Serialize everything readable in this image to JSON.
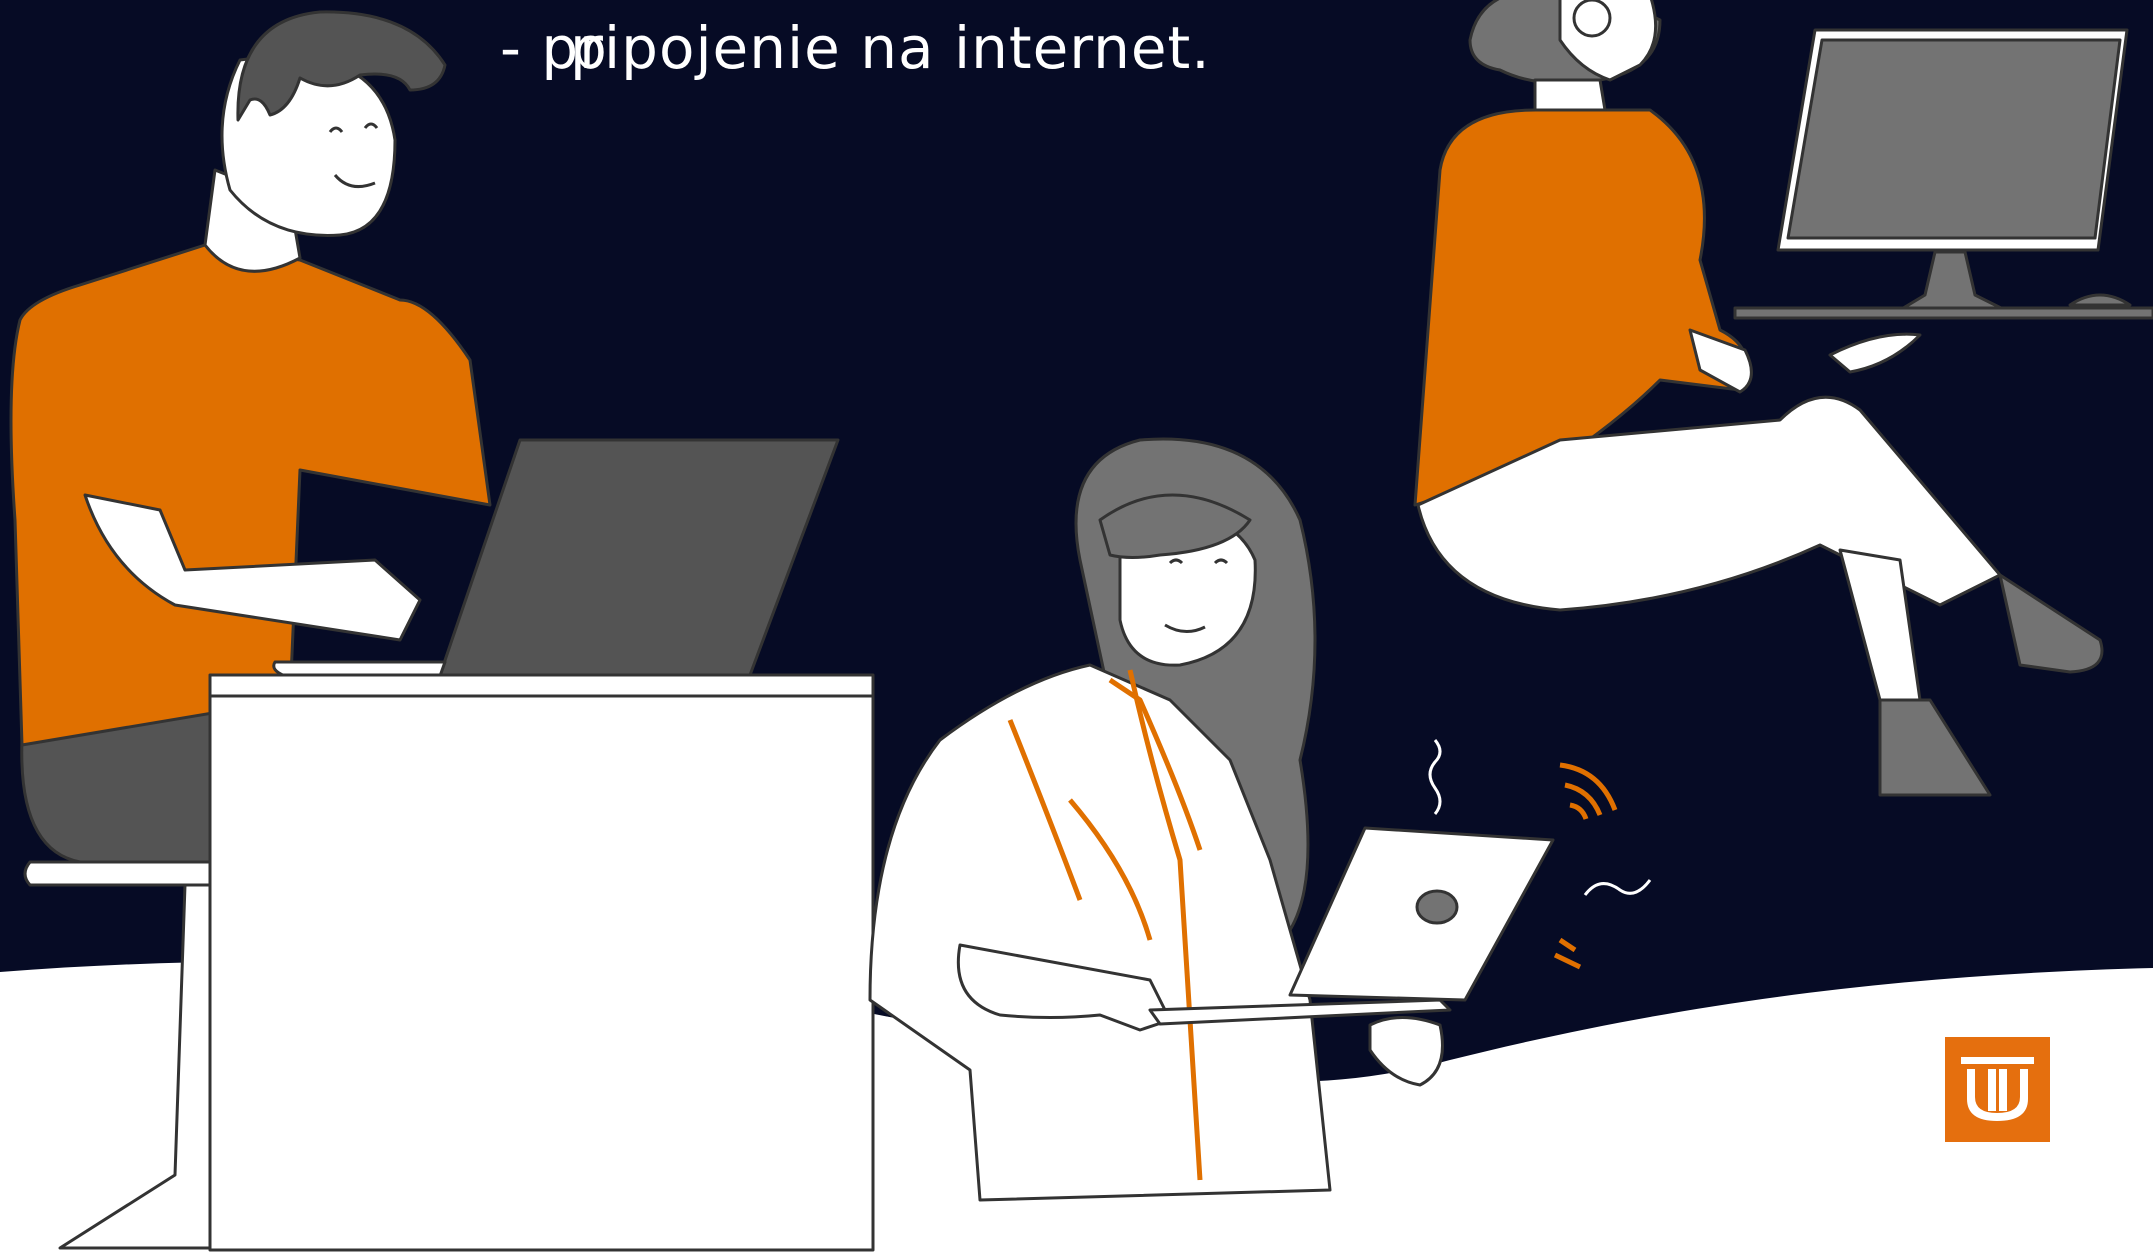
{
  "caption": {
    "line_partial": "p",
    "line_visible": "- pripojenie na internet."
  },
  "colors": {
    "background": "#060B25",
    "accent_orange": "#E56F0E",
    "shirt_orange": "#E07000",
    "gray_dark": "#545454",
    "gray_mid": "#737373",
    "white": "#FFFFFF"
  },
  "logo": {
    "icon": "tu-logo-icon"
  }
}
